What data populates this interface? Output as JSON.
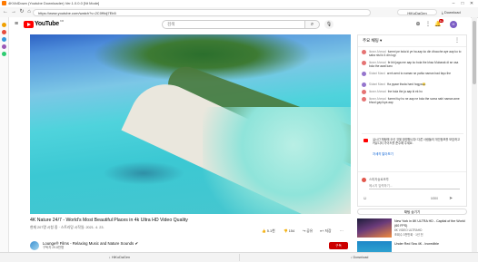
{
  "app": {
    "title": "4KVidDown (Youtube Downloader) Ver.1.0.0.0 [Nt Mode]",
    "hello_label": "HiKoDaGen",
    "download_label": "Download"
  },
  "browser": {
    "url": "https://www.youtube.com/watch?v=2C0f9dj7Eb5"
  },
  "youtube": {
    "logo_text": "YouTube",
    "region": "KR",
    "search_placeholder": "검색",
    "notification_count": "9+",
    "avatar_letter": "H"
  },
  "video": {
    "title": "4K Nature 24/7 - World's Most Beautiful Places in 4k Ultra HD Video Quality",
    "stats": "현재 207명 시청 중 · 스트리밍 시작일: 2021. 4. 23.",
    "likes": "5.1천",
    "dislikes": "154",
    "share": "공유",
    "save": "저장",
    "more": "···"
  },
  "channel": {
    "name": "Lounge® Films - Relaxing Music and Nature Sounds ✔",
    "subs": "구독자 29.8만명",
    "subscribe": "구독"
  },
  "chat": {
    "header": "주요 채팅 ▾",
    "messages": [
      {
        "author": "Ikram Ahmad",
        "text": "fummi pe bola ki ye ha aap ko din dhooche aye aap ko to saha nisi ki 4 din logi",
        "color": "#e57373"
      },
      {
        "author": "Ikram Ahmad",
        "text": "fe bhi jaga me aap ko bola the khao Mubarak di se vaa bola the awal karo",
        "color": "#e57373"
      },
      {
        "author": "Sidant Mand",
        "text": "arrrh aerd to naman se pahla naman bad fayo the",
        "color": "#9575cd"
      },
      {
        "author": "Sidant Mand",
        "text": "Ha pyaar thoda hard hogya😂",
        "color": "#9575cd"
      },
      {
        "author": "Ikram Ahmad",
        "text": "fne bola the ja aap ki ek ho",
        "color": "#e57373"
      },
      {
        "author": "Ikram Ahmad",
        "text": "fummi fuy ho ne aap ne bola the soma nahi naman ame bhool gayi kya aap",
        "color": "#e57373"
      }
    ],
    "notice": "실시간 채팅에 오신 것을 환영합니다! 다른 사람들의 개인정보를 보호하고 커뮤니티 가이드를 준수해 주세요.",
    "learn_more": "자세히 알아보기",
    "input_name": "스피지숭로조투",
    "input_placeholder": "메시지 입력하기...",
    "counter": "0/200",
    "hide": "채팅 숨기기"
  },
  "recommendations": [
    {
      "title": "New York in 8K ULTRA HD - Capital of the World (60 FPS)",
      "channel": "8K VIDEO ULTRAHD",
      "views": "조회수 3천만회 · 1년 전"
    },
    {
      "title": "Under Red Sea 4K - Incredible",
      "channel": "",
      "views": ""
    }
  ],
  "tabs": [
    "HiKoDaGen",
    "Download"
  ],
  "colors": {
    "yt_red": "#ff0000",
    "accent_blue": "#065fd4",
    "subscribe_red": "#cc0000"
  },
  "icons": [
    "back-icon",
    "forward-icon",
    "refresh-icon",
    "home-icon",
    "menu-icon",
    "search-icon",
    "mic-icon",
    "create-icon",
    "apps-icon",
    "bell-icon",
    "like-icon",
    "dislike-icon",
    "share-icon",
    "save-icon",
    "emoji-icon",
    "send-icon"
  ]
}
